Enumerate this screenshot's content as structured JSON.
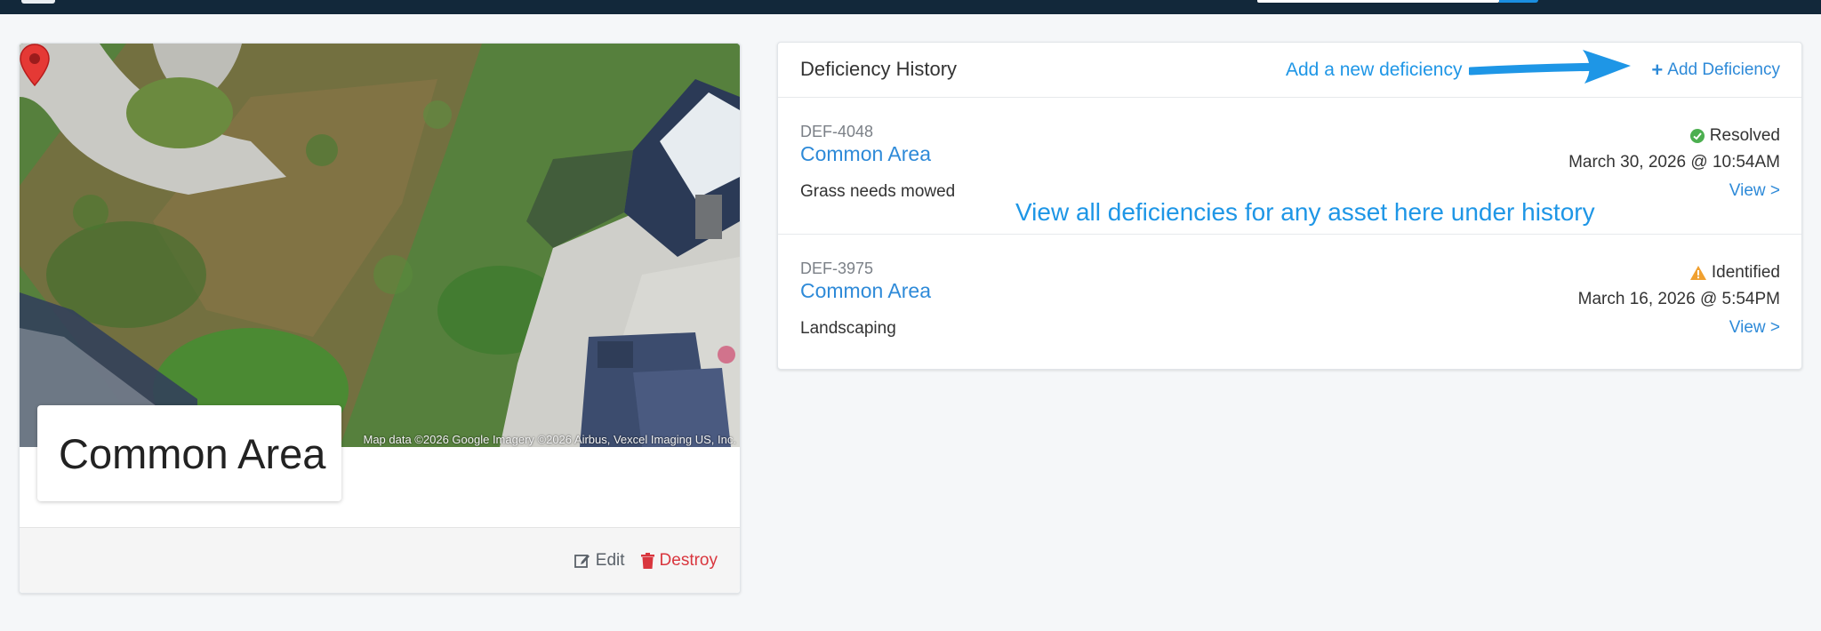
{
  "colors": {
    "accent": "#2e8ad8",
    "annotation": "#1e96e6",
    "destroy": "#d9363e",
    "resolved": "#4caf50",
    "identified": "#f0a030",
    "navbar": "#12283a"
  },
  "asset": {
    "title": "Common Area",
    "map_attribution": "Map data ©2026 Google Imagery ©2026 Airbus, Vexcel Imaging US, Inc.",
    "actions": {
      "edit_icon": "edit-icon",
      "edit_label": "Edit",
      "destroy_icon": "trash-icon",
      "destroy_label": "Destroy"
    }
  },
  "history": {
    "title": "Deficiency History",
    "add_label": "Add Deficiency",
    "rows": [
      {
        "id": "DEF-4048",
        "asset": "Common Area",
        "description": "Grass needs mowed",
        "status": "Resolved",
        "status_icon": "check-circle-icon",
        "date": "March 30, 2026 @ 10:54AM",
        "view_label": "View >"
      },
      {
        "id": "DEF-3975",
        "asset": "Common Area",
        "description": "Landscaping",
        "status": "Identified",
        "status_icon": "warning-icon",
        "date": "March 16, 2026 @ 5:54PM",
        "view_label": "View >"
      }
    ]
  },
  "annotations": {
    "add": "Add a new deficiency",
    "history": "View all deficiencies for any asset here under history"
  }
}
